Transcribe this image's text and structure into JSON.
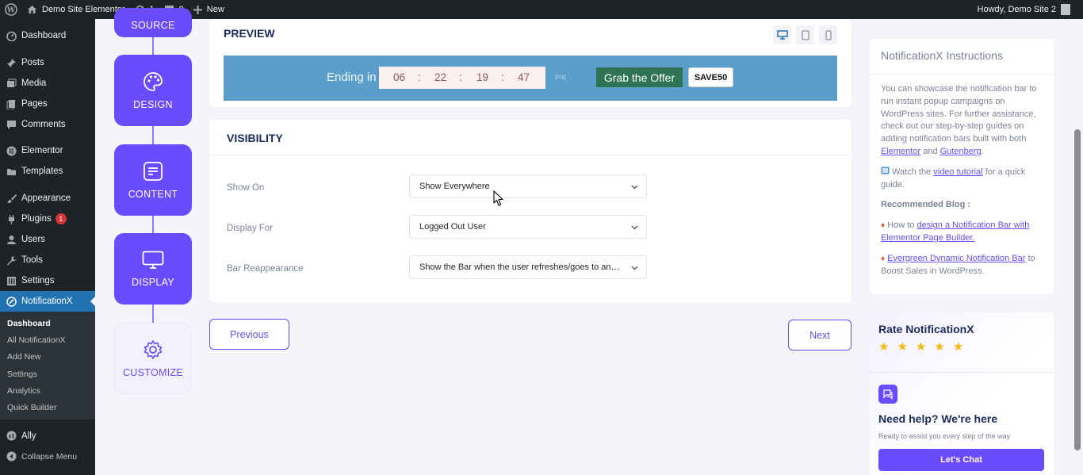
{
  "adminbar": {
    "site_name": "Demo Site Elementor",
    "updates_count": "1",
    "comments_count": "0",
    "new_label": "New",
    "greeting": "Howdy, Demo Site 2"
  },
  "sidebar": {
    "items": [
      {
        "label": "Dashboard",
        "icon": "dashboard-icon"
      },
      {
        "label": "Posts",
        "icon": "pin-icon"
      },
      {
        "label": "Media",
        "icon": "media-icon"
      },
      {
        "label": "Pages",
        "icon": "pages-icon"
      },
      {
        "label": "Comments",
        "icon": "comments-icon"
      },
      {
        "label": "Elementor",
        "icon": "elementor-icon"
      },
      {
        "label": "Templates",
        "icon": "folder-icon"
      },
      {
        "label": "Appearance",
        "icon": "brush-icon"
      },
      {
        "label": "Plugins",
        "icon": "plugin-icon",
        "badge": "1"
      },
      {
        "label": "Users",
        "icon": "users-icon"
      },
      {
        "label": "Tools",
        "icon": "wrench-icon"
      },
      {
        "label": "Settings",
        "icon": "settings-icon"
      },
      {
        "label": "NotificationX",
        "icon": "notificationx-icon"
      }
    ],
    "submenu": [
      "Dashboard",
      "All NotificationX",
      "Add New",
      "Settings",
      "Analytics",
      "Quick Builder"
    ],
    "bottom": [
      {
        "label": "Ally",
        "icon": "ally-icon"
      },
      {
        "label": "Collapse Menu",
        "icon": "collapse-icon"
      }
    ]
  },
  "steps": [
    {
      "label": "SOURCE",
      "icon": "source-icon"
    },
    {
      "label": "DESIGN",
      "icon": "palette-icon"
    },
    {
      "label": "CONTENT",
      "icon": "content-icon"
    },
    {
      "label": "DISPLAY",
      "icon": "monitor-icon"
    },
    {
      "label": "CUSTOMIZE",
      "icon": "gear-icon"
    }
  ],
  "preview": {
    "title": "PREVIEW",
    "bar": {
      "ending_label": "Ending in",
      "countdown": [
        "06",
        ":",
        "22",
        ":",
        "19",
        ":",
        "47"
      ],
      "tag": "png",
      "button_label": "Grab the Offer",
      "coupon": "SAVE50",
      "bar_color": "#5b9ec9",
      "button_color": "#2f7356"
    }
  },
  "visibility": {
    "title": "VISIBILITY",
    "rows": [
      {
        "label": "Show On",
        "value": "Show Everywhere"
      },
      {
        "label": "Display For",
        "value": "Logged Out User"
      },
      {
        "label": "Bar Reappearance",
        "value": "Show the Bar when the user refreshes/goes to anot..."
      }
    ]
  },
  "nav": {
    "previous": "Previous",
    "next": "Next"
  },
  "instructions": {
    "title": "NotificationX Instructions",
    "p1_text": "You can showcase the notification bar to run instant popup campaigns on WordPress sites. For further assistance, check out our step-by-step guides on adding notification bars built with both",
    "link_elementor": "Elementor",
    "and": "and",
    "link_gutenberg": "Gutenberg",
    "watch_prefix": "Watch the",
    "link_video": "video tutorial",
    "watch_suffix": "for a quick guide.",
    "recommended": "Recommended Blog :",
    "blog1_prefix": "How to",
    "blog1_link": "design a Notification Bar with Elementor Page Builder.",
    "blog2_link": "Evergreen Dynamic Notification Bar",
    "blog2_suffix": "to Boost Sales in WordPress."
  },
  "rate": {
    "title": "Rate NotificationX",
    "stars": 5,
    "help_title": "Need help? We're here",
    "help_sub": "Ready to assist you every step of the way",
    "chat_button": "Let's Chat"
  },
  "colors": {
    "accent": "#6a4bff",
    "admin_bar": "#1d2327",
    "menu_current": "#2271b1"
  }
}
